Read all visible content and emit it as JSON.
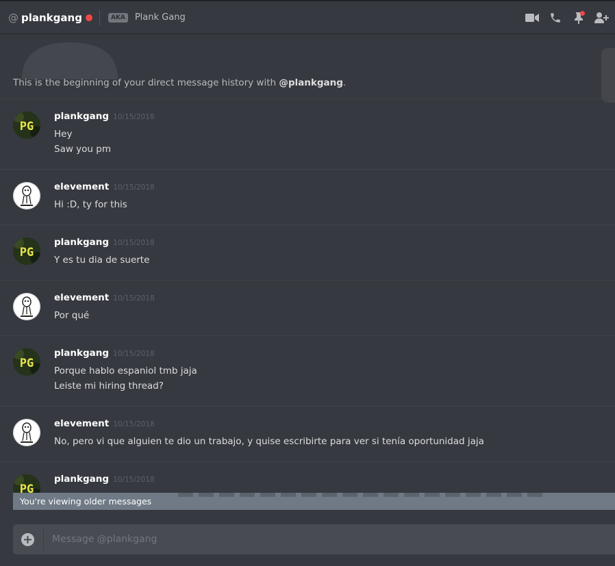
{
  "header": {
    "at_symbol": "@",
    "username": "plankgang",
    "aka_badge": "AKA",
    "aka_name": "Plank Gang",
    "icons": [
      "video-call-icon",
      "voice-call-icon",
      "pinned-messages-icon",
      "add-friend-icon"
    ]
  },
  "intro": {
    "prefix": "This is the beginning of your direct message history with ",
    "handle": "@plankgang",
    "suffix": "."
  },
  "messages": [
    {
      "author": "plankgang",
      "timestamp": "10/15/2018",
      "lines": [
        "Hey",
        "Saw you pm"
      ]
    },
    {
      "author": "elevement",
      "timestamp": "10/15/2018",
      "lines": [
        "Hi :D, ty for this"
      ]
    },
    {
      "author": "plankgang",
      "timestamp": "10/15/2018",
      "lines": [
        "Y es tu dia de suerte"
      ]
    },
    {
      "author": "elevement",
      "timestamp": "10/15/2018",
      "lines": [
        "Por qué"
      ]
    },
    {
      "author": "plankgang",
      "timestamp": "10/15/2018",
      "lines": [
        "Porque hablo espaniol tmb jaja",
        "Leiste mi hiring thread?"
      ]
    },
    {
      "author": "elevement",
      "timestamp": "10/15/2018",
      "lines": [
        "No, pero vi que alguien te dio un trabajo, y quise escribirte para ver si tenía oportunidad jaja"
      ]
    },
    {
      "author": "plankgang",
      "timestamp": "10/15/2018",
      "lines": []
    }
  ],
  "older_banner": "You're viewing older messages",
  "composer": {
    "placeholder": "Message @plankgang"
  },
  "colors": {
    "background": "#36393f",
    "status_dnd": "#f04747",
    "banner": "#6f7a86"
  }
}
